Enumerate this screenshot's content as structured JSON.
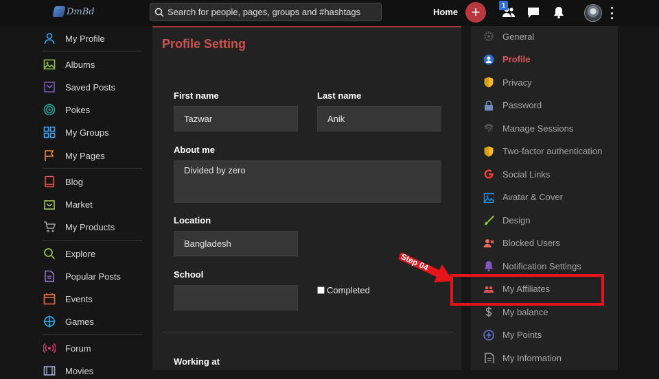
{
  "topbar": {
    "logo_text": "DmBd",
    "search_placeholder": "Search for people, pages, groups and #hashtags",
    "home_label": "Home",
    "plus_label": "+",
    "friend_badge": "1",
    "icons": [
      "friends-icon",
      "messages-icon",
      "bell-icon"
    ]
  },
  "sidebar": {
    "items": [
      {
        "label": "My Profile",
        "icon": "user-icon",
        "color": "#3fa9f5"
      },
      {
        "label": "Albums",
        "icon": "image-icon",
        "color": "#8bc34a"
      },
      {
        "label": "Saved Posts",
        "icon": "bookmark-icon",
        "color": "#7e57c2"
      },
      {
        "label": "Pokes",
        "icon": "target-icon",
        "color": "#26a69a"
      },
      {
        "label": "My Groups",
        "icon": "grid-icon",
        "color": "#42a5f5"
      },
      {
        "label": "My Pages",
        "icon": "flag-icon",
        "color": "#ef8a3c"
      },
      {
        "label": "Blog",
        "icon": "book-icon",
        "color": "#ef5350"
      },
      {
        "label": "Market",
        "icon": "bag-icon",
        "color": "#9ccc65"
      },
      {
        "label": "My Products",
        "icon": "cart-icon",
        "color": "#9e9e9e"
      },
      {
        "label": "Explore",
        "icon": "search-icon",
        "color": "#8bc34a"
      },
      {
        "label": "Popular Posts",
        "icon": "document-icon",
        "color": "#9575cd"
      },
      {
        "label": "Events",
        "icon": "calendar-icon",
        "color": "#ef6c3a"
      },
      {
        "label": "Games",
        "icon": "crosshair-icon",
        "color": "#29b6f6"
      },
      {
        "label": "Forum",
        "icon": "broadcast-icon",
        "color": "#ec407a"
      },
      {
        "label": "Movies",
        "icon": "film-icon",
        "color": "#9fa8da"
      }
    ]
  },
  "main": {
    "title": "Profile Setting",
    "first_name_label": "First name",
    "first_name_value": "Tazwar",
    "last_name_label": "Last name",
    "last_name_value": "Anik",
    "about_label": "About me",
    "about_value": "Divided by zero",
    "location_label": "Location",
    "location_value": "Bangladesh",
    "school_label": "School",
    "school_value": "",
    "completed_label": "Completed",
    "working_label": "Working at"
  },
  "settings": {
    "items": [
      {
        "label": "General",
        "icon": "gear-icon",
        "color": "#555555"
      },
      {
        "label": "Profile",
        "icon": "profile-icon",
        "color": "#2e6fcf",
        "active": true
      },
      {
        "label": "Privacy",
        "icon": "shield-icon",
        "color": "#f5b82e"
      },
      {
        "label": "Password",
        "icon": "lock-icon",
        "color": "#6f8ab7"
      },
      {
        "label": "Manage Sessions",
        "icon": "fingerprint-icon",
        "color": "#5a5a5a"
      },
      {
        "label": "Two-factor authentication",
        "icon": "shield-icon",
        "color": "#f5b82e"
      },
      {
        "label": "Social Links",
        "icon": "google-icon",
        "color": "#ea4335"
      },
      {
        "label": "Avatar & Cover",
        "icon": "image-icon",
        "color": "#1e88e5"
      },
      {
        "label": "Design",
        "icon": "brush-icon",
        "color": "#8bc34a"
      },
      {
        "label": "Blocked Users",
        "icon": "user-block-icon",
        "color": "#ef6a5a"
      },
      {
        "label": "Notification Settings",
        "icon": "bell-icon",
        "color": "#7e57c2"
      },
      {
        "label": "My Affiliates",
        "icon": "users-icon",
        "color": "#e0575c"
      },
      {
        "label": "My balance",
        "icon": "dollar-icon",
        "color": "#9e9e9e"
      },
      {
        "label": "My Points",
        "icon": "points-icon",
        "color": "#5c6bc0"
      },
      {
        "label": "My Information",
        "icon": "document-icon",
        "color": "#9e9e9e"
      }
    ]
  },
  "annotation": {
    "step_text": "Step 04",
    "highlight_color": "#e4141b"
  }
}
